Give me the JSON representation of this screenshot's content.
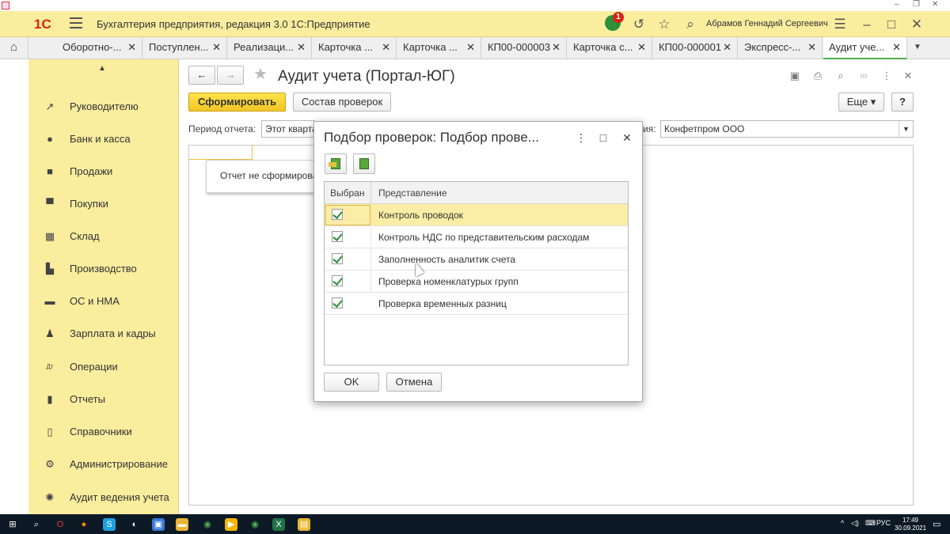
{
  "window": {
    "logo": "1С",
    "title": "Бухгалтерия предприятия, редакция 3.0 1С:Предприятие",
    "notification_count": "1",
    "user": "Абрамов Геннадий Сергеевич"
  },
  "tabs": [
    {
      "label": "Оборотно-..."
    },
    {
      "label": "Поступлен..."
    },
    {
      "label": "Реализаци..."
    },
    {
      "label": "Карточка ..."
    },
    {
      "label": "Карточка ..."
    },
    {
      "label": "КП00-000003"
    },
    {
      "label": "Карточка с..."
    },
    {
      "label": "КП00-000001"
    },
    {
      "label": "Экспресс-..."
    },
    {
      "label": "Аудит уче..."
    }
  ],
  "sidebar": {
    "items": [
      {
        "label": "Руководителю",
        "icon": "trend-icon"
      },
      {
        "label": "Банк и касса",
        "icon": "coin-icon"
      },
      {
        "label": "Продажи",
        "icon": "bag-icon"
      },
      {
        "label": "Покупки",
        "icon": "cart-icon"
      },
      {
        "label": "Склад",
        "icon": "warehouse-icon"
      },
      {
        "label": "Производство",
        "icon": "factory-icon"
      },
      {
        "label": "ОС и НМА",
        "icon": "truck-icon"
      },
      {
        "label": "Зарплата и кадры",
        "icon": "person-icon"
      },
      {
        "label": "Операции",
        "icon": "dt-kt-icon"
      },
      {
        "label": "Отчеты",
        "icon": "bar-chart-icon"
      },
      {
        "label": "Справочники",
        "icon": "books-icon"
      },
      {
        "label": "Администрирование",
        "icon": "gear-icon"
      },
      {
        "label": "Аудит ведения учета",
        "icon": "audit-icon"
      }
    ]
  },
  "form": {
    "title": "Аудит учета (Портал-ЮГ)",
    "generate_label": "Сформировать",
    "checks_label": "Состав проверок",
    "more_label": "Еще",
    "help_label": "?",
    "period_label": "Период отчета:",
    "period_value": "Этот кварта",
    "org_label": "ия:",
    "org_value": "Конфетпром ООО",
    "report_note": "Отчет не сформирован"
  },
  "dialog": {
    "title": "Подбор проверок: Подбор прове...",
    "col_selected": "Выбран",
    "col_name": "Представление",
    "rows": [
      {
        "name": "Контроль проводок",
        "checked": true
      },
      {
        "name": "Контроль НДС по представительским расходам",
        "checked": true
      },
      {
        "name": "Заполненность аналитик счета",
        "checked": true
      },
      {
        "name": "Проверка номенклатурых групп",
        "checked": true
      },
      {
        "name": "Проверка временных разниц",
        "checked": true
      }
    ],
    "ok_label": "OK",
    "cancel_label": "Отмена"
  },
  "taskbar": {
    "lang": "РУС",
    "time": "17:49",
    "date": "30.09.2021"
  }
}
